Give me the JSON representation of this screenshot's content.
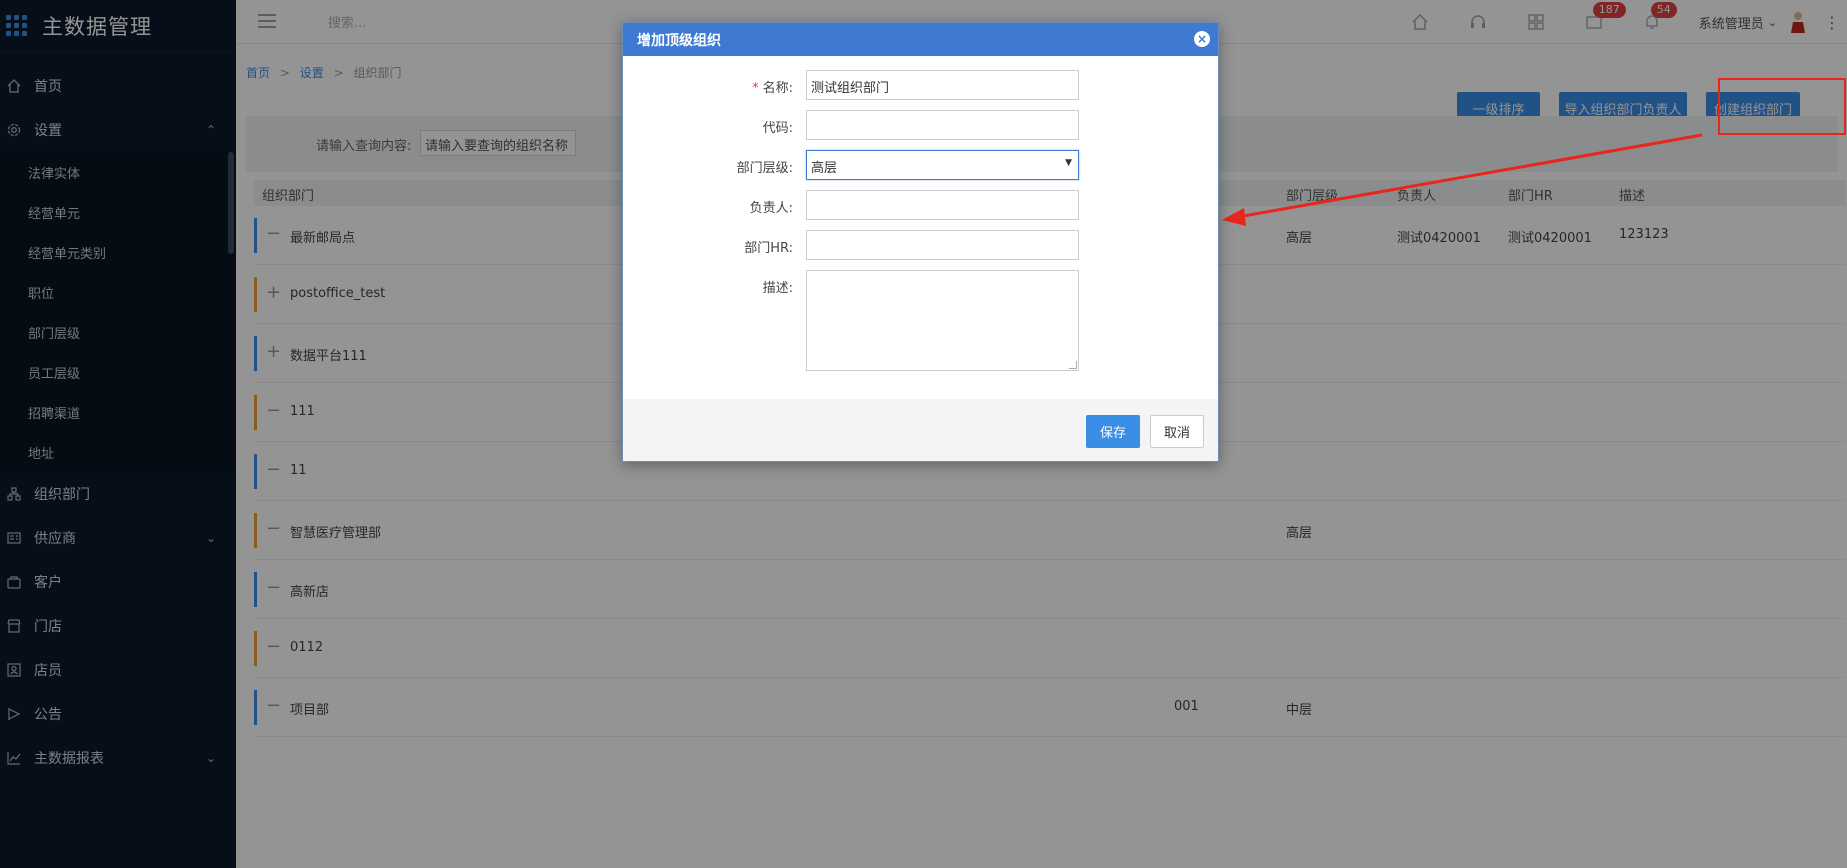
{
  "app": {
    "title": "主数据管理"
  },
  "sidebar": {
    "items": [
      {
        "label": "首页",
        "icon": "home-icon"
      },
      {
        "label": "设置",
        "icon": "gear-icon",
        "expanded": true
      },
      {
        "label": "组织部门",
        "icon": "org-icon"
      },
      {
        "label": "供应商",
        "icon": "supplier-icon"
      },
      {
        "label": "客户",
        "icon": "customer-icon"
      },
      {
        "label": "门店",
        "icon": "store-icon"
      },
      {
        "label": "店员",
        "icon": "staff-icon"
      },
      {
        "label": "公告",
        "icon": "announcement-icon"
      },
      {
        "label": "主数据报表",
        "icon": "report-icon"
      }
    ],
    "settings_children": [
      "法律实体",
      "经营单元",
      "经营单元类别",
      "职位",
      "部门层级",
      "员工层级",
      "招聘渠道",
      "地址"
    ]
  },
  "topbar": {
    "search_placeholder": "搜索...",
    "badge_mail": "187",
    "badge_bell": "54",
    "user_name": "系统管理员"
  },
  "breadcrumb": {
    "home": "首页",
    "settings": "设置",
    "current": "组织部门",
    "sep": ">"
  },
  "actions": {
    "sort": "一级排序",
    "import": "导入组织部门负责人",
    "create": "创建组织部门"
  },
  "filter": {
    "label": "请输入查询内容:",
    "placeholder": "请输入要查询的组织名称"
  },
  "table": {
    "headers": [
      "组织部门",
      "部门层级",
      "负责人",
      "部门HR",
      "描述"
    ],
    "rows": [
      {
        "name": "最新邮局点",
        "toggle": "−",
        "code": "",
        "level": "高层",
        "owner": "测试0420001",
        "hr": "测试0420001",
        "desc": "123123",
        "bar": "#3a8ee6"
      },
      {
        "name": "postoffice_test",
        "toggle": "+",
        "code": "",
        "level": "",
        "owner": "",
        "hr": "",
        "desc": "",
        "bar": "#f0a030"
      },
      {
        "name": "数据平台111",
        "toggle": "+",
        "code": "",
        "level": "",
        "owner": "",
        "hr": "",
        "desc": "",
        "bar": "#3a8ee6"
      },
      {
        "name": "111",
        "toggle": "−",
        "code": "",
        "level": "",
        "owner": "",
        "hr": "",
        "desc": "",
        "bar": "#f0a030"
      },
      {
        "name": "11",
        "toggle": "−",
        "code": "",
        "level": "",
        "owner": "",
        "hr": "",
        "desc": "",
        "bar": "#3a8ee6"
      },
      {
        "name": "智慧医疗管理部",
        "toggle": "−",
        "code": "",
        "level": "高层",
        "owner": "",
        "hr": "",
        "desc": "",
        "bar": "#f0a030"
      },
      {
        "name": "高新店",
        "toggle": "−",
        "code": "",
        "level": "",
        "owner": "",
        "hr": "",
        "desc": "",
        "bar": "#3a8ee6"
      },
      {
        "name": "0112",
        "toggle": "−",
        "code": "",
        "level": "",
        "owner": "",
        "hr": "",
        "desc": "",
        "bar": "#f0a030"
      },
      {
        "name": "项目部",
        "toggle": "−",
        "code": "001",
        "level": "中层",
        "owner": "",
        "hr": "",
        "desc": "",
        "bar": "#3a8ee6"
      }
    ]
  },
  "dialog": {
    "title": "增加顶级组织",
    "close": "×",
    "fields": {
      "name_label": "名称:",
      "name_value": "测试组织部门",
      "code_label": "代码:",
      "code_value": "",
      "level_label": "部门层级:",
      "level_value": "高层",
      "owner_label": "负责人:",
      "owner_value": "",
      "hr_label": "部门HR:",
      "hr_value": "",
      "desc_label": "描述:",
      "desc_value": ""
    },
    "save": "保存",
    "cancel": "取消"
  },
  "colors": {
    "accent": "#3a8ee6",
    "dialog_header": "#3e7ad1",
    "annotation": "#e8261b"
  }
}
